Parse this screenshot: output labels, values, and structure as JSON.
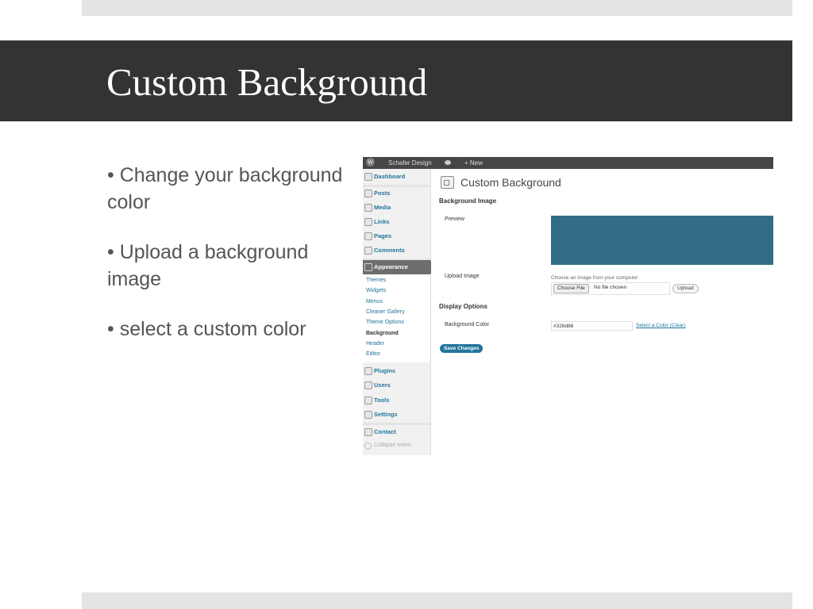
{
  "slide": {
    "title": "Custom Background",
    "bullets": [
      "• Change your background color",
      "• Upload a background image",
      "• select a custom color"
    ]
  },
  "screenshot": {
    "admin_bar": {
      "wp_logo": "W",
      "site_name": "Schafer Design",
      "comments_icon": "comment-bubble-icon",
      "new_label": "+ New"
    },
    "sidebar": {
      "items": [
        {
          "label": "Dashboard",
          "icon": "dashboard-icon"
        },
        {
          "label": "Posts",
          "icon": "pin-icon"
        },
        {
          "label": "Media",
          "icon": "media-icon"
        },
        {
          "label": "Links",
          "icon": "link-icon"
        },
        {
          "label": "Pages",
          "icon": "pages-icon"
        },
        {
          "label": "Comments",
          "icon": "comment-icon"
        },
        {
          "label": "Appearance",
          "icon": "appearance-icon"
        },
        {
          "label": "Plugins",
          "icon": "plugin-icon"
        },
        {
          "label": "Users",
          "icon": "users-icon"
        },
        {
          "label": "Tools",
          "icon": "tools-icon"
        },
        {
          "label": "Settings",
          "icon": "settings-icon"
        },
        {
          "label": "Contact",
          "icon": "contact-icon"
        }
      ],
      "appearance_sub": [
        "Themes",
        "Widgets",
        "Menus",
        "Cleaner Gallery",
        "Theme Options",
        "Background",
        "Header",
        "Editor"
      ],
      "current_sub": "Background",
      "collapse_label": "Collapse menu"
    },
    "main": {
      "heading": "Custom Background",
      "section_image": "Background Image",
      "preview_label": "Preview",
      "preview_color": "#326d86",
      "upload_label": "Upload Image",
      "choose_text": "Choose an image from your computer:",
      "choose_file_btn": "Choose File",
      "no_file_text": "No file chosen",
      "upload_btn": "Upload",
      "section_display": "Display Options",
      "bg_color_label": "Background Color",
      "bg_color_value": "#326d86",
      "select_color_link": "Select a Color",
      "clear_link": "(Clear)",
      "save_btn": "Save Changes"
    }
  },
  "colors": {
    "title_bar": "#333333",
    "accent": "#21759b",
    "preview": "#326d86"
  }
}
